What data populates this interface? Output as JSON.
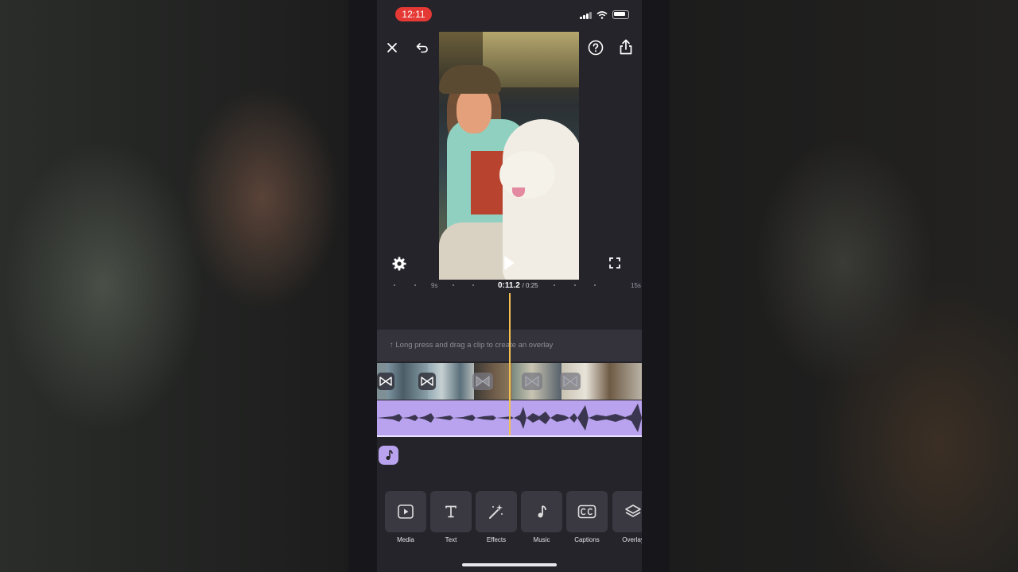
{
  "status_bar": {
    "time": "12:11"
  },
  "header": {
    "close_icon": "close-icon",
    "undo_icon": "undo-icon",
    "help_icon": "help-icon",
    "share_icon": "share-icon"
  },
  "player": {
    "settings_icon": "gear-icon",
    "play_icon": "play-icon",
    "fullscreen_icon": "fullscreen-icon"
  },
  "timeline": {
    "tick_start": "9s",
    "tick_end": "15s",
    "current_time": "0:11.2",
    "total_time": "/ 0:25",
    "overlay_hint": "↑ Long press and drag a clip to create an overlay",
    "playhead_color": "#f2c14e",
    "audio_color": "#b9a3ef"
  },
  "toolbar": {
    "items": [
      {
        "label": "Media",
        "icon": "media-icon"
      },
      {
        "label": "Text",
        "icon": "text-icon"
      },
      {
        "label": "Effects",
        "icon": "magic-wand-icon"
      },
      {
        "label": "Music",
        "icon": "music-note-icon"
      },
      {
        "label": "Captions",
        "icon": "cc-icon"
      },
      {
        "label": "Overlay",
        "icon": "layers-icon"
      }
    ]
  }
}
